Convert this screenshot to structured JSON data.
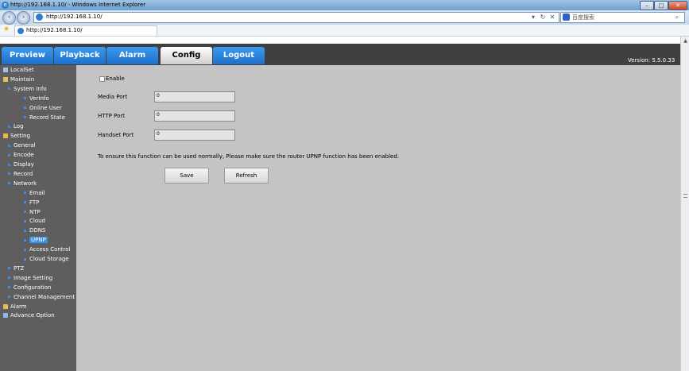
{
  "browser": {
    "title": "http://192.168.1.10/ - Windows Internet Explorer",
    "address": "http://192.168.1.10/",
    "search_placeholder": "百度搜索",
    "tab_title": "http://192.168.1.10/",
    "window_buttons": [
      "–",
      "□",
      "✕"
    ]
  },
  "menu": {
    "tabs": [
      "Preview",
      "Playback",
      "Alarm",
      "Config",
      "Logout"
    ],
    "active": "Config",
    "version": "Version: 5.5.0.33"
  },
  "sidebar": {
    "items": [
      {
        "label": "LocalSet",
        "level": 0,
        "icon": "monitor-icon"
      },
      {
        "label": "Maintain",
        "level": 0,
        "icon": "wrench-icon"
      },
      {
        "label": "System Info",
        "level": 1
      },
      {
        "label": "VerInfo",
        "level": 2
      },
      {
        "label": "Online User",
        "level": 2
      },
      {
        "label": "Record State",
        "level": 2
      },
      {
        "label": "Log",
        "level": 1
      },
      {
        "label": "Setting",
        "level": 0,
        "icon": "folder-icon"
      },
      {
        "label": "General",
        "level": 1
      },
      {
        "label": "Encode",
        "level": 1
      },
      {
        "label": "Display",
        "level": 1
      },
      {
        "label": "Record",
        "level": 1
      },
      {
        "label": "Network",
        "level": 1
      },
      {
        "label": "Email",
        "level": 2
      },
      {
        "label": "FTP",
        "level": 2
      },
      {
        "label": "NTP",
        "level": 2
      },
      {
        "label": "Cloud",
        "level": 2
      },
      {
        "label": "DDNS",
        "level": 2
      },
      {
        "label": "UPNP",
        "level": 2,
        "selected": true
      },
      {
        "label": "Access Control",
        "level": 2
      },
      {
        "label": "Cloud Storage",
        "level": 2
      },
      {
        "label": "PTZ",
        "level": 1
      },
      {
        "label": "Image Setting",
        "level": 1
      },
      {
        "label": "Configuration",
        "level": 1
      },
      {
        "label": "Channel Management",
        "level": 1
      },
      {
        "label": "Alarm",
        "level": 0,
        "icon": "alarm-icon"
      },
      {
        "label": "Advance Option",
        "level": 0,
        "icon": "tools-icon"
      }
    ]
  },
  "form": {
    "enable_label": "Enable",
    "media_port_label": "Media Port",
    "media_port_value": "0",
    "http_port_label": "HTTP Port",
    "http_port_value": "0",
    "handset_port_label": "Handset Port",
    "handset_port_value": "0",
    "notice": "To ensure this function can be used normally, Please make sure the router UPNP function has been enabled.",
    "save_label": "Save",
    "refresh_label": "Refresh"
  },
  "colors": {
    "tab_blue": "#2a86e0",
    "menubar": "#404040",
    "sidebar": "#5e5e5e",
    "content": "#c4c4c4",
    "selected_item": "#3a8fe8"
  }
}
